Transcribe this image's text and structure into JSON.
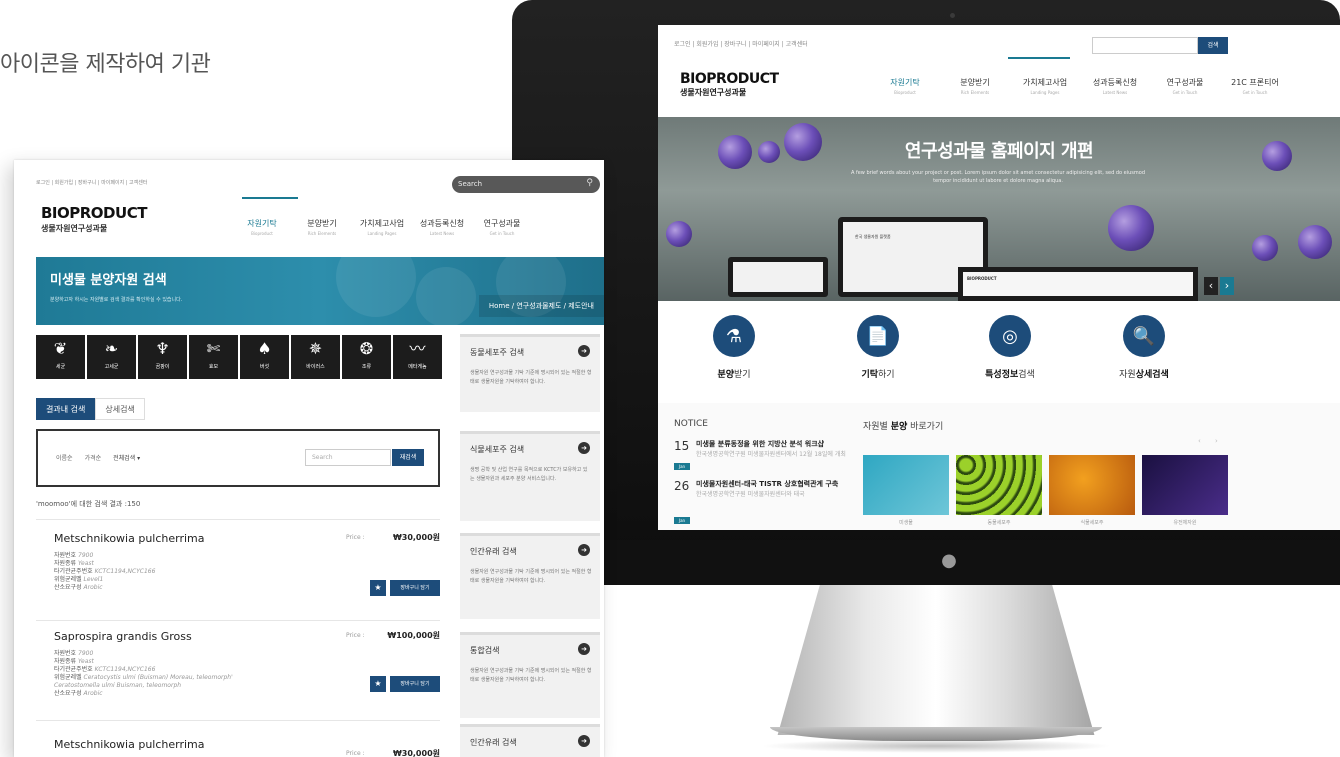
{
  "caption": "아이콘을 제작하여 기관",
  "monitor": {
    "util_links": "로그인  |  회원가입  |  장바구니  |  마이페이지  |  고객센터",
    "search_btn": "검색",
    "logo": "BIOPRODUCT",
    "logo_sub": "생물자원연구성과물",
    "nav": [
      {
        "label": "자원기탁",
        "sub": "Bioproduct"
      },
      {
        "label": "분양받기",
        "sub": "Rich Elements"
      },
      {
        "label": "가치제고사업",
        "sub": "Landing Pages"
      },
      {
        "label": "성과등록신청",
        "sub": "Latest News"
      },
      {
        "label": "연구성과물",
        "sub": "Get in Touch"
      },
      {
        "label": "21C 프론티어",
        "sub": "Get in Touch"
      }
    ],
    "hero_title": "연구성과물 홈페이지 개편",
    "hero_sub": "A few brief words about your project or post. Lorem ipsum dolor sit amet consectetur adipisicing elit, sed do eiusmod tempor incididunt ut labore et dolore magna aliqua.",
    "hero_prev": "‹",
    "hero_next": "›",
    "tablet_caption": "한국 생물자원 플랫폼",
    "mini_logo": "BIOPRODUCT",
    "quick": [
      {
        "label_a": "분양",
        "label_b": "받기",
        "icon": "flask-icon",
        "glyph": "⚗"
      },
      {
        "label_a": "기탁",
        "label_b": "하기",
        "icon": "document-icon",
        "glyph": "📄"
      },
      {
        "label_a": "특성정보",
        "label_b": "검색",
        "icon": "fingerprint-icon",
        "glyph": "◎"
      },
      {
        "label_a": "자원",
        "label_b": "상세검색",
        "icon": "search-doc-icon",
        "glyph": "🔍"
      }
    ],
    "notice_title": "NOTICE",
    "notices": [
      {
        "day": "15",
        "month": "Jan",
        "title": "미생물 분류동정을 위한 지방산 분석 워크샵",
        "text": "한국생명공학연구원 미생물자원센터에서 12월 18일에 개최"
      },
      {
        "day": "26",
        "month": "Jan",
        "title": "미생물자원센터-태국 TISTR 상호협력관계 구축",
        "text": "한국생명공학연구원 미생물자원센터와 태국"
      }
    ],
    "go_title_a": "자원별 ",
    "go_title_b": "분양",
    "go_title_c": " 바로가기",
    "go_nav": "‹ ›",
    "go_items": [
      "미생물",
      "동물세포주",
      "식물세포주",
      "유전체자원"
    ]
  },
  "tablet": {
    "util_links": "로그인  |  회원가입  |  장바구니  |  마이페이지  |  고객센터",
    "search_placeholder": "Search",
    "logo": "BIOPRODUCT",
    "logo_sub": "생물자원연구성과물",
    "nav": [
      {
        "label": "자원기탁",
        "sub": "Bioproduct"
      },
      {
        "label": "분양받기",
        "sub": "Rich Elements"
      },
      {
        "label": "가치제고사업",
        "sub": "Landing Pages"
      },
      {
        "label": "성과등록신청",
        "sub": "Latest News"
      },
      {
        "label": "연구성과물",
        "sub": "Get in Touch"
      }
    ],
    "banner_title": "미생물 분양자원 검색",
    "banner_sub": "분양하고자 하시는 자원별로 검색 결과를 확인하실 수 있습니다.",
    "breadcrumb": "Home  /  연구성과물제도  /  제도안내",
    "categories": [
      {
        "label": "세균",
        "icon": "bacteria-icon",
        "glyph": "❦"
      },
      {
        "label": "고세균",
        "icon": "archaea-icon",
        "glyph": "❧"
      },
      {
        "label": "곰팡이",
        "icon": "mold-icon",
        "glyph": "♆"
      },
      {
        "label": "효모",
        "icon": "yeast-icon",
        "glyph": "✄"
      },
      {
        "label": "버섯",
        "icon": "mushroom-icon",
        "glyph": "♠"
      },
      {
        "label": "바이러스",
        "icon": "virus-icon",
        "glyph": "✵"
      },
      {
        "label": "조류",
        "icon": "algae-icon",
        "glyph": "❂"
      },
      {
        "label": "메타게놈",
        "icon": "metagenome-icon",
        "glyph": "〰"
      }
    ],
    "tabs": [
      "결과내 검색",
      "상세검색"
    ],
    "filter_options": [
      "이름순",
      "가격순",
      "전체검색 ▾"
    ],
    "filter_placeholder": "Search",
    "filter_btn": "재검색",
    "result_count": "'moomoo'에 대한 검색 결과 :150",
    "results": [
      {
        "name": "Metschnikowia pulcherrima",
        "price_label": "Price :",
        "price": "₩30,000원",
        "meta": [
          {
            "k": "자원번호 ",
            "v": "7900"
          },
          {
            "k": "자원종류 ",
            "v": "Yeast"
          },
          {
            "k": "타기관균주번호 ",
            "v": "KCTC1194,NCYC166"
          },
          {
            "k": "위험균레벨 ",
            "v": "Level1"
          },
          {
            "k": "산소요구성 ",
            "v": "Arobic"
          }
        ],
        "star": "★",
        "cart": "장바구니 담기"
      },
      {
        "name": "Saprospira grandis Gross",
        "price_label": "Price :",
        "price": "₩100,000원",
        "meta": [
          {
            "k": "자원번호 ",
            "v": "7900"
          },
          {
            "k": "자원종류 ",
            "v": "Yeast"
          },
          {
            "k": "타기관균주번호 ",
            "v": "KCTC1194,NCYC166"
          },
          {
            "k": "위험균레벨 ",
            "v": "Ceratocystis ulmi (Buisman) Moreau, teleomorph'"
          },
          {
            "k": "",
            "v": "Ceratostomella ulmi Buisman, teleomorph"
          },
          {
            "k": "산소요구성 ",
            "v": "Arobic"
          }
        ],
        "star": "★",
        "cart": "장바구니 담기"
      },
      {
        "name": "Metschnikowia pulcherrima",
        "price_label": "Price :",
        "price": "₩30,000원"
      }
    ],
    "side": [
      {
        "title": "동물세포주 검색",
        "text": "생물자원 연구성과물 기탁 기준에 명시되어 있는 적절한 형태로 생물자원을 기탁하여야 합니다."
      },
      {
        "title": "식물세포주 검색",
        "text": "생명 공학 및 산업 연구를 목적으로 KCTC가 보유하고 있는 생물자원과 세포주 분양 서비스입니다."
      },
      {
        "title": "인간유래 검색",
        "text": "생물자원 연구성과물 기탁 기준에 명시되어 있는 적절한 형태로 생물자원을 기탁하여야 합니다."
      },
      {
        "title": "통합검색",
        "text": "생물자원 연구성과물 기탁 기준에 명시되어 있는 적절한 형태로 생물자원을 기탁하여야 합니다."
      },
      {
        "title": "인간유래 검색",
        "text": ""
      }
    ],
    "arrow": "➜"
  },
  "colors": {
    "navy": "#1d4c7a",
    "teal": "#1a7a92",
    "banner": "#2d8eac"
  }
}
